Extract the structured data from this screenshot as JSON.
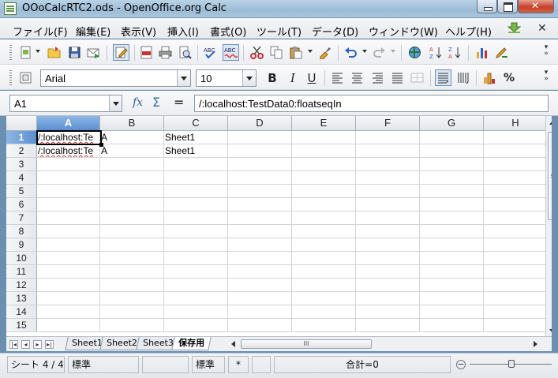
{
  "window": {
    "title": "OOoCalcRTC2.ods - OpenOffice.org Calc"
  },
  "menu": [
    "ファイル(F)",
    "編集(E)",
    "表示(V)",
    "挿入(I)",
    "書式(O)",
    "ツール(T)",
    "データ(D)",
    "ウィンドウ(W)",
    "ヘルプ(H)"
  ],
  "formatting": {
    "font_name": "Arial",
    "font_size": "10",
    "bold": "B",
    "italic": "I",
    "underline": "U",
    "percent": "%"
  },
  "formula_bar": {
    "name_box": "A1",
    "fx": "fx",
    "sigma": "Σ",
    "equals": "=",
    "content": "/:localhost:TestData0:floatseqIn"
  },
  "grid": {
    "columns": [
      "A",
      "B",
      "C",
      "D",
      "E",
      "F",
      "G",
      "H"
    ],
    "selected_column": "A",
    "rows": [
      "1",
      "2",
      "3",
      "4",
      "5",
      "6",
      "7",
      "8",
      "9",
      "10",
      "11",
      "12",
      "13",
      "14",
      "15"
    ],
    "selected_row": "1",
    "cells": [
      {
        "ref": "A1",
        "value": "/:localhost:Te"
      },
      {
        "ref": "B1",
        "value": "A"
      },
      {
        "ref": "C1",
        "value": "Sheet1"
      },
      {
        "ref": "A2",
        "value": "/:localhost:Te"
      },
      {
        "ref": "B2",
        "value": "A"
      },
      {
        "ref": "C2",
        "value": "Sheet1"
      }
    ]
  },
  "sheet_tabs": {
    "tabs": [
      "Sheet1",
      "Sheet2",
      "Sheet3",
      "保存用"
    ],
    "active": "保存用",
    "hscroll_grip": "III"
  },
  "status": {
    "sheet": "シート 4 / 4",
    "page_style": "標準",
    "field3": "",
    "mode": "標準",
    "modified": "*",
    "field6": "",
    "sum": "合計=0"
  },
  "colors": {
    "selected_header": "#5b8fd0",
    "title_bar": "#9dbcd6",
    "spell_error": "#d03030"
  }
}
